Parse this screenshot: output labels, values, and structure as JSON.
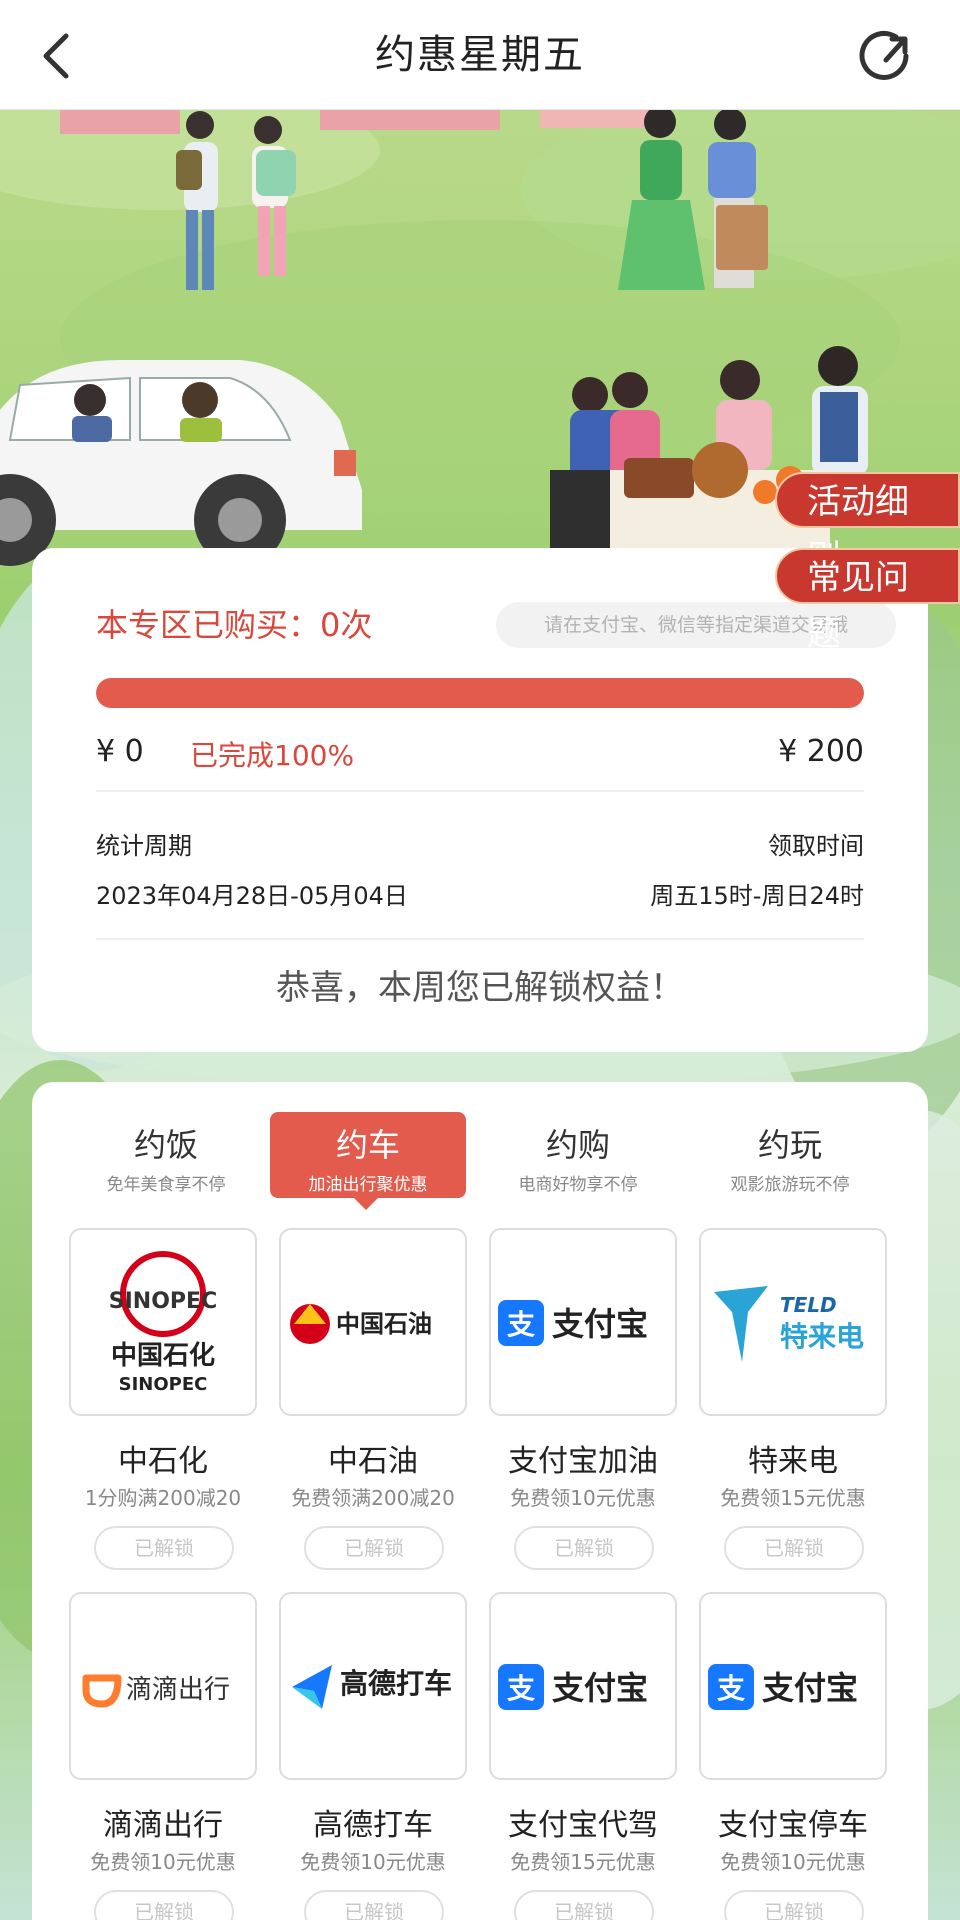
{
  "nav": {
    "title": "约惠星期五"
  },
  "side_buttons": {
    "rules": "活动细则",
    "faq": "常见问题"
  },
  "stats": {
    "purchased": "本专区已购买：0次",
    "hint": "请在支付宝、微信等指定渠道交易哦",
    "progress_percent": 100,
    "amount_start": "¥ 0",
    "completed": "已完成100%",
    "amount_end": "¥ 200",
    "period_label": "统计周期",
    "period_value": "2023年04月28日-05月04日",
    "claim_label": "领取时间",
    "claim_value": "周五15时-周日24时",
    "congrats": "恭喜，本周您已解锁权益！"
  },
  "tabs": [
    {
      "main": "约饭",
      "sub": "免年美食享不停"
    },
    {
      "main": "约车",
      "sub": "加油出行聚优惠"
    },
    {
      "main": "约购",
      "sub": "电商好物享不停"
    },
    {
      "main": "约玩",
      "sub": "观影旅游玩不停"
    }
  ],
  "merchants": [
    {
      "name": "中石化",
      "offer": "1分购满200减20",
      "button": "已解锁",
      "logo_text": "中国石化",
      "logo_sub": "SINOPEC",
      "logo_mark": "SINOPEC"
    },
    {
      "name": "中石油",
      "offer": "免费领满200减20",
      "button": "已解锁",
      "logo_text": "中国石油"
    },
    {
      "name": "支付宝加油",
      "offer": "免费领10元优惠",
      "button": "已解锁",
      "logo_text": "支付宝"
    },
    {
      "name": "特来电",
      "offer": "免费领15元优惠",
      "button": "已解锁",
      "logo_text": "特来电",
      "logo_sub": "TELD"
    },
    {
      "name": "滴滴出行",
      "offer": "免费领10元优惠",
      "button": "已解锁",
      "logo_text": "滴滴出行"
    },
    {
      "name": "高德打车",
      "offer": "免费领10元优惠",
      "button": "已解锁",
      "logo_text": "高德打车"
    },
    {
      "name": "支付宝代驾",
      "offer": "免费领15元优惠",
      "button": "已解锁",
      "logo_text": "支付宝"
    },
    {
      "name": "支付宝停车",
      "offer": "免费领10元优惠",
      "button": "已解锁",
      "logo_text": "支付宝"
    }
  ],
  "colors": {
    "accent": "#e35b4d",
    "accent_dark": "#c8382f",
    "alipay_blue": "#1677ff",
    "petro_red": "#d4001a",
    "didi_orange": "#ff7b2d"
  }
}
